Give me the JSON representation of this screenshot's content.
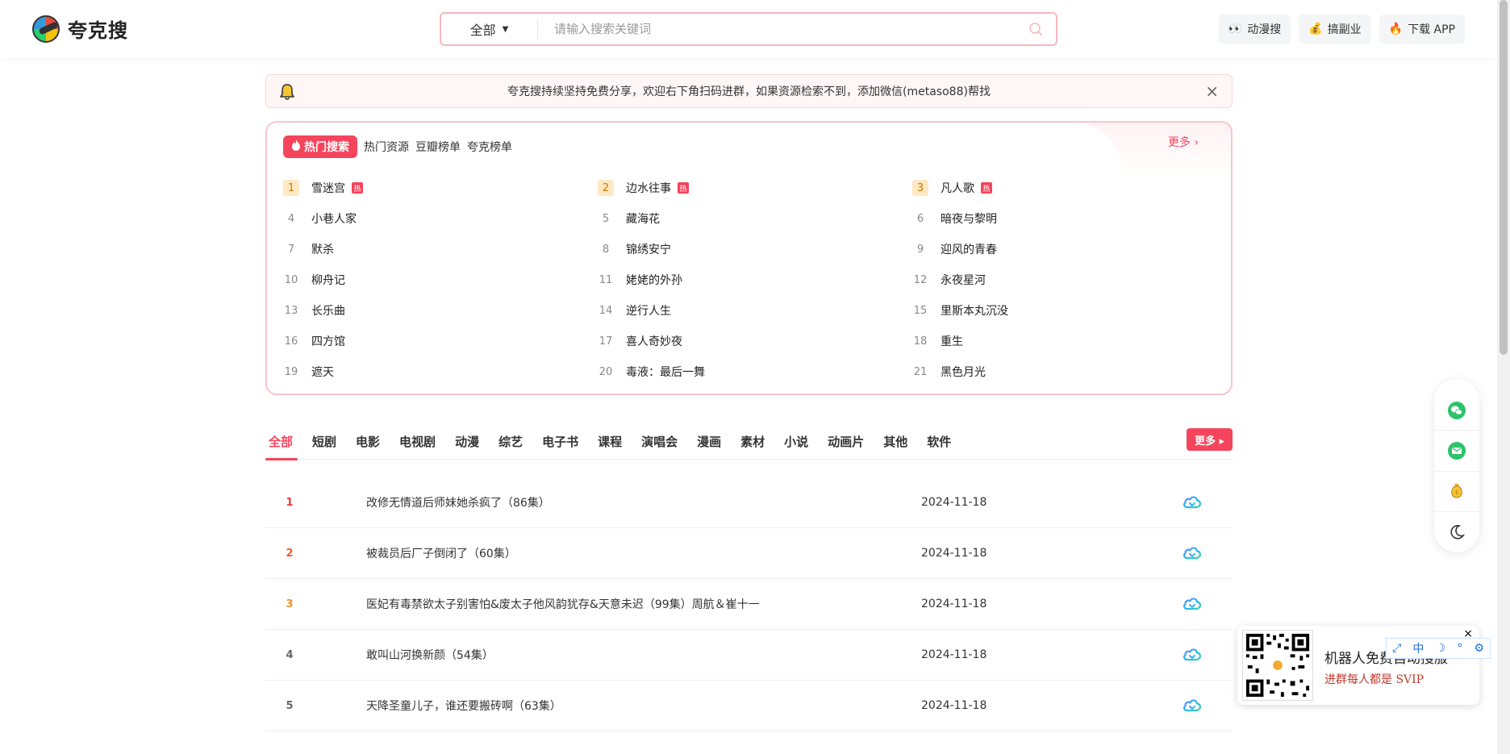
{
  "header": {
    "logo_text": "夸克搜",
    "search_category": "全部",
    "search_placeholder": "请输入搜索关键词",
    "buttons": [
      {
        "icon": "eyes-icon",
        "label": "动漫搜"
      },
      {
        "icon": "money-bag-icon",
        "label": "搞副业"
      },
      {
        "icon": "fire-icon",
        "label": "下载 APP"
      }
    ]
  },
  "notice": {
    "text": "夸克搜持续坚持免费分享，欢迎右下角扫码进群，如果资源检索不到，添加微信(metaso88)帮找"
  },
  "hot": {
    "badge": "热门搜索",
    "links": [
      "热门资源",
      "豆瓣榜单",
      "夸克榜单"
    ],
    "more": "更多 ›",
    "tag": "热",
    "items": [
      {
        "rank": "1",
        "title": "雪迷宫",
        "hot": true
      },
      {
        "rank": "2",
        "title": "边水往事",
        "hot": true
      },
      {
        "rank": "3",
        "title": "凡人歌",
        "hot": true
      },
      {
        "rank": "4",
        "title": "小巷人家"
      },
      {
        "rank": "5",
        "title": "藏海花"
      },
      {
        "rank": "6",
        "title": "暗夜与黎明"
      },
      {
        "rank": "7",
        "title": "默杀"
      },
      {
        "rank": "8",
        "title": "锦绣安宁"
      },
      {
        "rank": "9",
        "title": "迎风的青春"
      },
      {
        "rank": "10",
        "title": "柳舟记"
      },
      {
        "rank": "11",
        "title": "姥姥的外孙"
      },
      {
        "rank": "12",
        "title": "永夜星河"
      },
      {
        "rank": "13",
        "title": "长乐曲"
      },
      {
        "rank": "14",
        "title": "逆行人生"
      },
      {
        "rank": "15",
        "title": "里斯本丸沉没"
      },
      {
        "rank": "16",
        "title": "四方馆"
      },
      {
        "rank": "17",
        "title": "喜人奇妙夜"
      },
      {
        "rank": "18",
        "title": "重生"
      },
      {
        "rank": "19",
        "title": "遮天"
      },
      {
        "rank": "20",
        "title": "毒液：最后一舞"
      },
      {
        "rank": "21",
        "title": "黑色月光"
      }
    ]
  },
  "categories": {
    "tabs": [
      "全部",
      "短剧",
      "电影",
      "电视剧",
      "动漫",
      "综艺",
      "电子书",
      "课程",
      "演唱会",
      "漫画",
      "素材",
      "小说",
      "动画片",
      "其他",
      "软件"
    ],
    "active": "全部",
    "more": "更多 ▸"
  },
  "list": [
    {
      "rank": "1",
      "title": "改修无情道后师妹她杀疯了（86集）",
      "date": "2024-11-18"
    },
    {
      "rank": "2",
      "title": "被裁员后厂子倒闭了（60集）",
      "date": "2024-11-18"
    },
    {
      "rank": "3",
      "title": "医妃有毒禁欲太子别害怕&废太子他风韵犹存&天意未迟（99集）周航＆崔十一",
      "date": "2024-11-18"
    },
    {
      "rank": "4",
      "title": "敢叫山河换新颜（54集）",
      "date": "2024-11-18"
    },
    {
      "rank": "5",
      "title": "天降圣童儿子，谁还要搬砖啊（63集）",
      "date": "2024-11-18"
    }
  ],
  "qr": {
    "line1": "机器人免费自动搜服",
    "line2": "进群每人都是 SVIP",
    "close": "×"
  },
  "mini_toolbar": [
    "⤢",
    "中",
    "☽",
    "°",
    "⚙"
  ],
  "colors": {
    "accent": "#f5455c",
    "border_pink": "#f8c5cb"
  }
}
